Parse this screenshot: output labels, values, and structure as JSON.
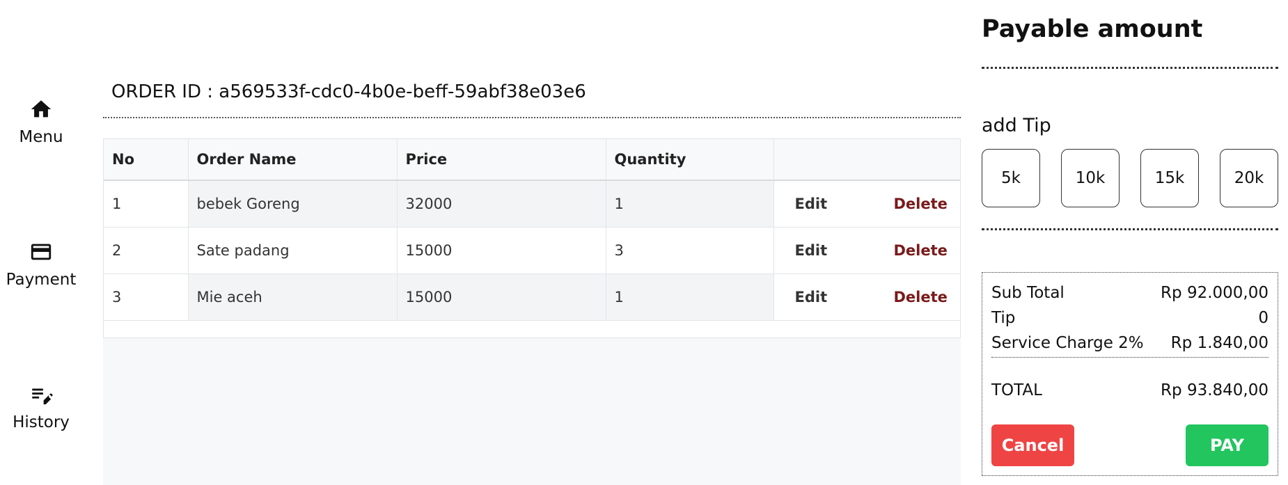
{
  "sidebar": {
    "items": [
      {
        "label": "Menu",
        "icon": "home-icon"
      },
      {
        "label": "Payment",
        "icon": "credit-card-icon"
      },
      {
        "label": "History",
        "icon": "edit-list-icon"
      }
    ]
  },
  "order": {
    "id_text": "ORDER ID : a569533f-cdc0-4b0e-beff-59abf38e03e6"
  },
  "table": {
    "headers": [
      "No",
      "Order Name",
      "Price",
      "Quantity",
      ""
    ],
    "rows": [
      {
        "no": "1",
        "name": "bebek Goreng",
        "price": "32000",
        "qty": "1"
      },
      {
        "no": "2",
        "name": "Sate padang",
        "price": "15000",
        "qty": "3"
      },
      {
        "no": "3",
        "name": "Mie aceh",
        "price": "15000",
        "qty": "1"
      }
    ],
    "edit_label": "Edit",
    "delete_label": "Delete"
  },
  "panel": {
    "title": "Payable amount",
    "tip_title": "add Tip",
    "tips": [
      "5k",
      "10k",
      "15k",
      "20k"
    ],
    "summary": {
      "subtotal_label": "Sub Total",
      "subtotal_value": "Rp 92.000,00",
      "tip_label": "Tip",
      "tip_value": "0",
      "service_label": "Service Charge 2%",
      "service_value": "Rp 1.840,00",
      "total_label": "TOTAL",
      "total_value": "Rp 93.840,00"
    },
    "cancel_label": "Cancel",
    "pay_label": "PAY"
  },
  "colors": {
    "cancel": "#ef4444",
    "pay": "#22c55e",
    "delete_text": "#7a1a1a"
  }
}
